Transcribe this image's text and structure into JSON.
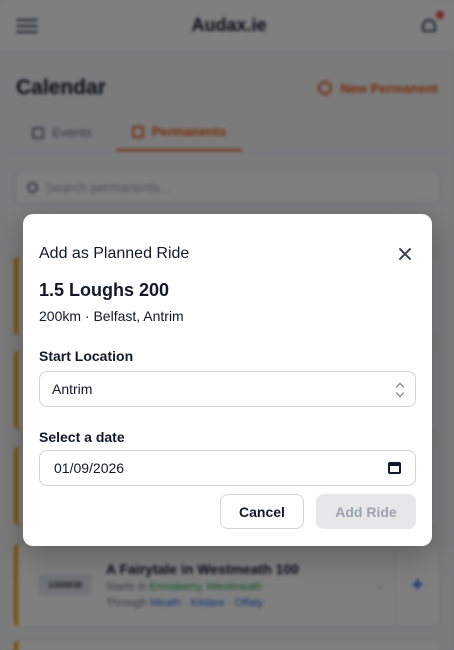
{
  "app": {
    "brand": "Audax.ie",
    "page_title": "Calendar",
    "new_permanent_label": "New Permanent",
    "tabs": [
      {
        "label": "Events",
        "active": false
      },
      {
        "label": "Permanents",
        "active": true
      }
    ],
    "search": {
      "placeholder": "Search permanents..."
    },
    "cards": [
      {
        "badge": "1000KM",
        "title": "A Fairytale in Westmeath 100",
        "start_prefix": "Starts in",
        "start_location": "Enniskerry, Westmeath",
        "through_prefix": "Through",
        "through": [
          "Meath",
          "Kildare",
          "Offaly"
        ]
      }
    ]
  },
  "modal": {
    "title": "Add as Planned Ride",
    "ride_name": "1.5 Loughs 200",
    "ride_meta": "200km · Belfast, Antrim",
    "start_location_label": "Start Location",
    "start_location_value": "Antrim",
    "date_label": "Select a date",
    "date_value": "01/09/2026",
    "cancel_label": "Cancel",
    "add_label": "Add Ride"
  },
  "colors": {
    "accent": "#ea580c",
    "overlay": "rgba(0,0,0,0.5)",
    "link": "#2563eb",
    "start_green": "#16a34a",
    "card_stripe": "#f59e0b"
  }
}
